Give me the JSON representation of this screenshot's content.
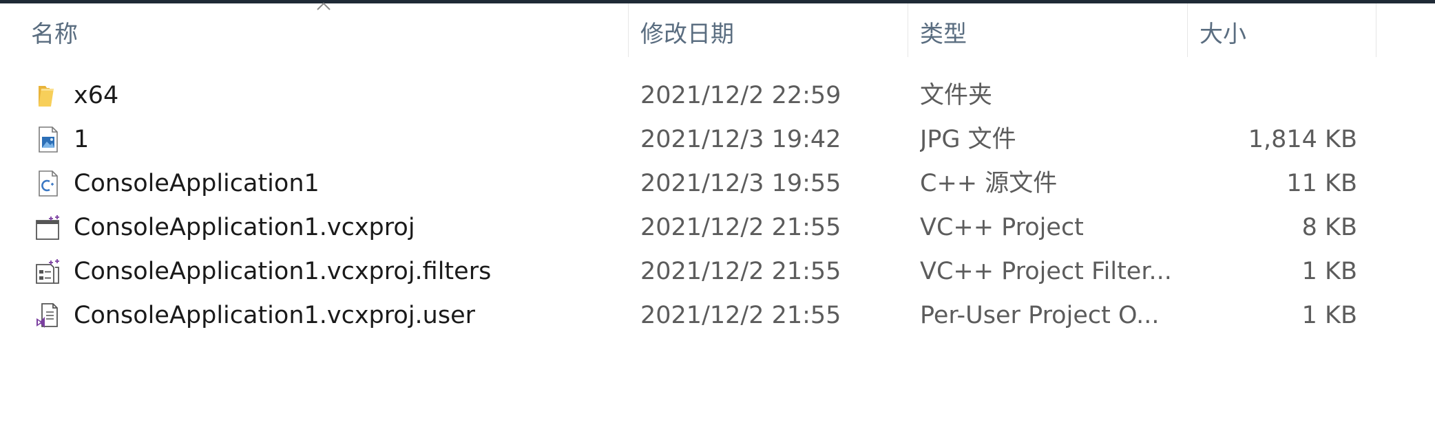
{
  "columns": {
    "name": "名称",
    "date": "修改日期",
    "type": "类型",
    "size": "大小"
  },
  "sort": {
    "column": "name",
    "direction": "ascending",
    "icon": "chevron-up-icon"
  },
  "files": [
    {
      "name": "x64",
      "date": "2021/12/2 22:59",
      "type": "文件夹",
      "size": "",
      "icon": "folder-icon"
    },
    {
      "name": "1",
      "date": "2021/12/3 19:42",
      "type": "JPG 文件",
      "size": "1,814 KB",
      "icon": "image-file-icon"
    },
    {
      "name": "ConsoleApplication1",
      "date": "2021/12/3 19:55",
      "type": "C++ 源文件",
      "size": "11 KB",
      "icon": "cpp-source-icon"
    },
    {
      "name": "ConsoleApplication1.vcxproj",
      "date": "2021/12/2 21:55",
      "type": "VC++ Project",
      "size": "8 KB",
      "icon": "vcxproj-icon"
    },
    {
      "name": "ConsoleApplication1.vcxproj.filters",
      "date": "2021/12/2 21:55",
      "type": "VC++ Project Filter...",
      "size": "1 KB",
      "icon": "vcxproj-filters-icon"
    },
    {
      "name": "ConsoleApplication1.vcxproj.user",
      "date": "2021/12/2 21:55",
      "type": "Per-User Project O...",
      "size": "1 KB",
      "icon": "vs-user-file-icon"
    }
  ],
  "colors": {
    "header_text": "#5a6d80",
    "folder": "#f5c542",
    "visual_studio_purple": "#7b3fa0",
    "top_bar": "#1f2a36"
  }
}
